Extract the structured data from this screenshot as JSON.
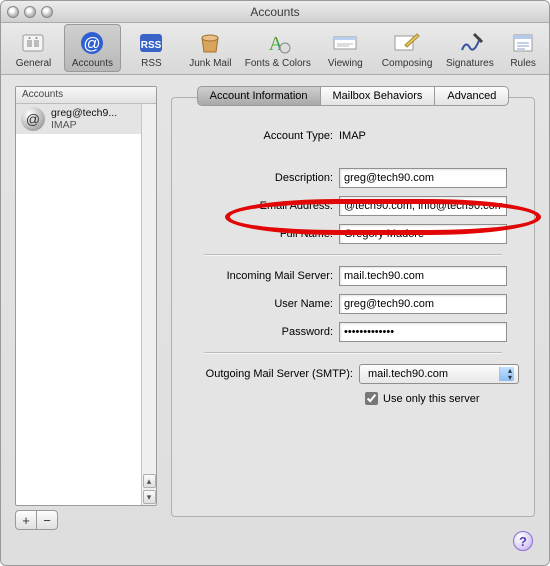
{
  "window": {
    "title": "Accounts"
  },
  "toolbar": {
    "items": [
      {
        "label": "General"
      },
      {
        "label": "Accounts"
      },
      {
        "label": "RSS"
      },
      {
        "label": "Junk Mail"
      },
      {
        "label": "Fonts & Colors"
      },
      {
        "label": "Viewing"
      },
      {
        "label": "Composing"
      },
      {
        "label": "Signatures"
      },
      {
        "label": "Rules"
      }
    ],
    "selected_index": 1
  },
  "sidebar": {
    "header": "Accounts",
    "accounts": [
      {
        "name": "greg@tech9...",
        "sub": "IMAP"
      }
    ]
  },
  "tabs": {
    "items": [
      "Account Information",
      "Mailbox Behaviors",
      "Advanced"
    ],
    "active_index": 0
  },
  "fields": {
    "account_type_label": "Account Type:",
    "account_type_value": "IMAP",
    "description_label": "Description:",
    "description_value": "greg@tech90.com",
    "email_label": "Email Address:",
    "email_value": "@tech90.com, info@tech90.com",
    "fullname_label": "Full Name:",
    "fullname_value": "Gregory Madore",
    "incoming_label": "Incoming Mail Server:",
    "incoming_value": "mail.tech90.com",
    "username_label": "User Name:",
    "username_value": "greg@tech90.com",
    "password_label": "Password:",
    "password_value": "•••••••••••••",
    "smtp_label": "Outgoing Mail Server (SMTP):",
    "smtp_value": "mail.tech90.com",
    "use_only_label": "Use only this server",
    "use_only_checked": true
  },
  "buttons": {
    "add": "+",
    "remove": "−",
    "help": "?"
  }
}
